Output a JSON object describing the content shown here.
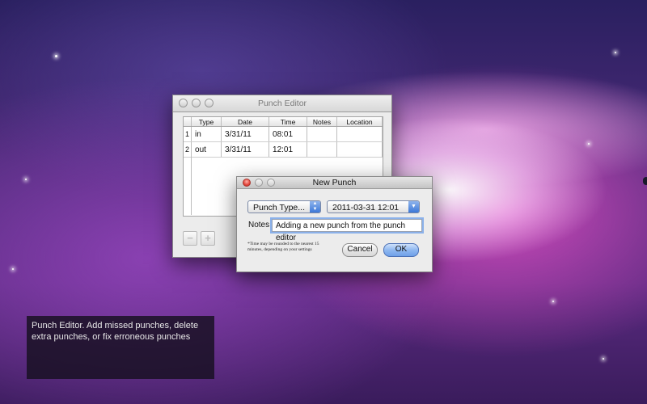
{
  "punch_editor": {
    "title": "Punch Editor",
    "columns": [
      "Type",
      "Date",
      "Time",
      "Notes",
      "Location"
    ],
    "rows": [
      {
        "num": "1",
        "type": "in",
        "date": "3/31/11",
        "time": "08:01",
        "notes": "",
        "location": ""
      },
      {
        "num": "2",
        "type": "out",
        "date": "3/31/11",
        "time": "12:01",
        "notes": "",
        "location": ""
      }
    ],
    "remove_label": "−",
    "add_label": "+"
  },
  "new_punch": {
    "title": "New Punch",
    "punch_type": "Punch Type...",
    "datetime": "2011-03-31 12:01",
    "notes_label": "Notes:",
    "notes_value": "Adding a new punch from the punch editor",
    "rounding_note": "*Time may be rounded to the nearest 15 minutes, depending on your settings",
    "cancel_label": "Cancel",
    "ok_label": "OK"
  },
  "caption": {
    "text": "Punch Editor. Add missed punches, delete extra punches, or fix erroneous punches"
  }
}
